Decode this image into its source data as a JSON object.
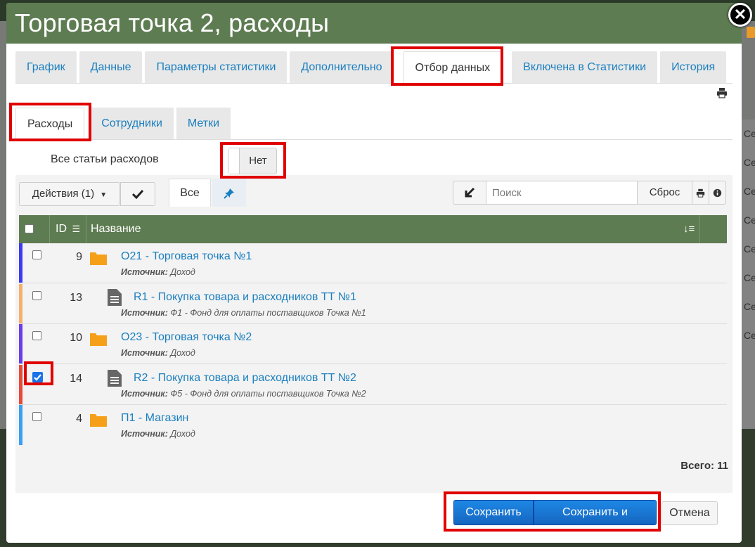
{
  "modal": {
    "title": "Торговая точка 2, расходы",
    "close_glyph": "✕"
  },
  "background": {
    "side_items": [
      "Се",
      "Се",
      "Се",
      "Се",
      "Се",
      "Се",
      "Се",
      "Се"
    ]
  },
  "tabs": [
    {
      "label": "График",
      "active": false
    },
    {
      "label": "Данные",
      "active": false
    },
    {
      "label": "Параметры статистики",
      "active": false
    },
    {
      "label": "Дополнительно",
      "active": false
    },
    {
      "label": "Отбор данных",
      "active": true
    },
    {
      "label": "Включена в Статистики",
      "active": false
    },
    {
      "label": "История",
      "active": false
    }
  ],
  "subtabs": [
    {
      "label": "Расходы",
      "active": true
    },
    {
      "label": "Сотрудники",
      "active": false
    },
    {
      "label": "Метки",
      "active": false
    }
  ],
  "filter": {
    "all_label": "Все статьи расходов",
    "toggle_value": "Нет"
  },
  "toolbar": {
    "actions_label": "Действия (1)",
    "all_label": "Все",
    "search_placeholder": "Поиск",
    "reset_label": "Сброс"
  },
  "table": {
    "col_id": "ID",
    "col_name": "Название",
    "rows": [
      {
        "id": "9",
        "type": "folder",
        "title": "О21 - Торговая точка №1",
        "source_label": "Источник:",
        "source": "Доход",
        "checked": false,
        "bar_color": "#3b3bf2"
      },
      {
        "id": "13",
        "type": "doc",
        "title": "R1 - Покупка товара и расходников ТТ №1",
        "source_label": "Источник:",
        "source": "Ф1 - Фонд для оплаты поставщиков Точка №1",
        "checked": false,
        "bar_color": "#f5b06a"
      },
      {
        "id": "10",
        "type": "folder",
        "title": "О23 - Торговая точка №2",
        "source_label": "Источник:",
        "source": "Доход",
        "checked": false,
        "bar_color": "#6a3ee8"
      },
      {
        "id": "14",
        "type": "doc",
        "title": "R2 - Покупка товара и расходников ТТ №2",
        "source_label": "Источник:",
        "source": "Ф5 - Фонд для оплаты поставщиков Точка №2",
        "checked": true,
        "bar_color": "#e84a3a"
      },
      {
        "id": "4",
        "type": "folder",
        "title": "П1 - Магазин",
        "source_label": "Источник:",
        "source": "Доход",
        "checked": false,
        "bar_color": "#3aa0f2"
      }
    ]
  },
  "total_label": "Всего: 11",
  "footer": {
    "save_label": "Сохранить",
    "save_exit_label": "Сохранить и выйти",
    "cancel_label": "Отмена"
  },
  "colors": {
    "header_green": "#5e7c52",
    "link_blue": "#1a7fbf",
    "primary_blue": "#1565c0",
    "highlight_red": "#e00000",
    "folder_orange": "#f6a019"
  }
}
